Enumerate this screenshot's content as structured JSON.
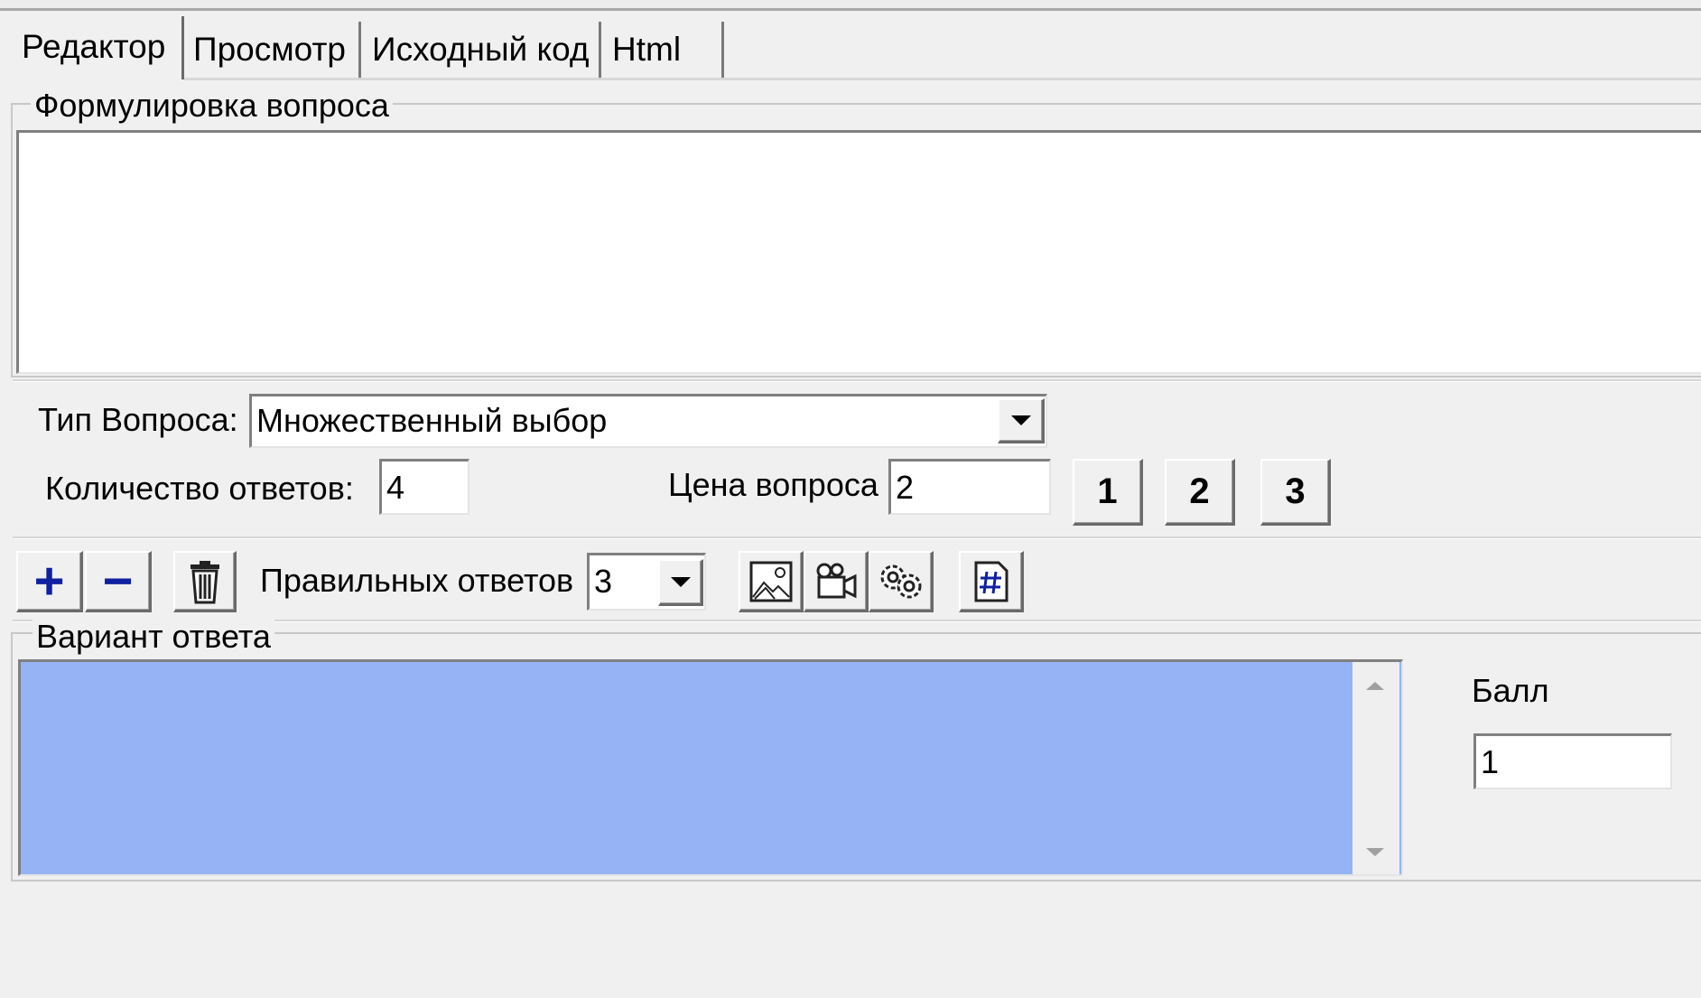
{
  "tabs": [
    {
      "label": "Редактор",
      "active": true
    },
    {
      "label": "Просмотр",
      "active": false
    },
    {
      "label": "Исходный код",
      "active": false
    },
    {
      "label": "Html",
      "active": false
    }
  ],
  "question_group": {
    "label": "Формулировка вопроса",
    "text": ""
  },
  "question_type": {
    "label": "Тип Вопроса:",
    "value": "Множественный выбор"
  },
  "answers_count": {
    "label": "Количество ответов:",
    "value": "4"
  },
  "question_price": {
    "label": "Цена вопроса",
    "value": "2"
  },
  "level_buttons": [
    "1",
    "2",
    "3"
  ],
  "toolbar": {
    "add_label": "+",
    "remove_label": "−",
    "correct_answers_label": "Правильных ответов",
    "correct_answers_value": "3"
  },
  "answer_group": {
    "label": "Вариант ответа",
    "selected_color": "#95b3f5"
  },
  "score": {
    "label": "Балл",
    "value": "1"
  }
}
